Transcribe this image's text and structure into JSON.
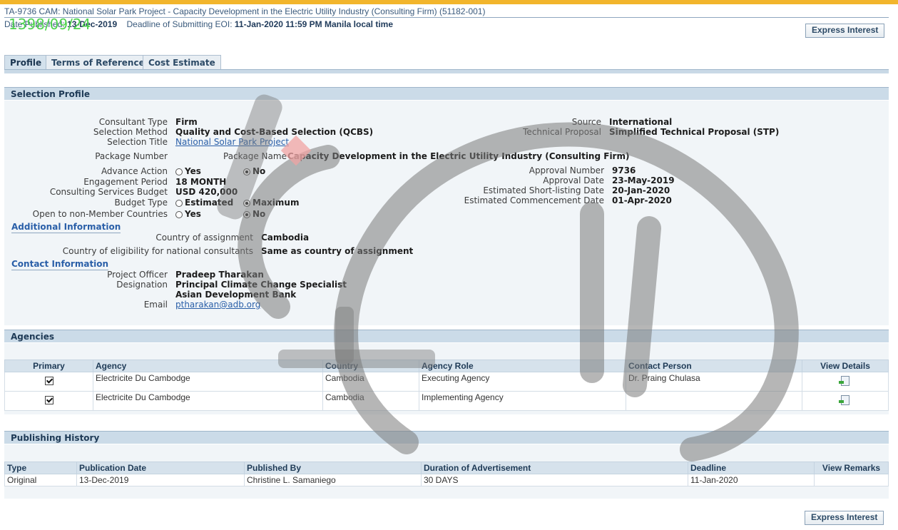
{
  "header": {
    "title": "TA-9736 CAM: National Solar Park Project - Capacity Development in the Electric Utility Industry (Consulting Firm) (51182-001)",
    "date_published_label": "Date Published:",
    "date_published_value": "13-Dec-2019",
    "deadline_label": "Deadline of Submitting EOI:",
    "deadline_value": "11-Jan-2020 11:59 PM Manila local time",
    "stamp": "1398/09/24",
    "express_interest": "Express Interest"
  },
  "tabs": [
    {
      "label": "Profile",
      "active": true
    },
    {
      "label": "Terms of Reference",
      "active": false
    },
    {
      "label": "Cost Estimate",
      "active": false
    }
  ],
  "selection_profile": {
    "heading": "Selection Profile",
    "consultant_type_label": "Consultant Type",
    "consultant_type": "Firm",
    "selection_method_label": "Selection Method",
    "selection_method": "Quality and Cost-Based Selection (QCBS)",
    "selection_title_label": "Selection Title",
    "selection_title": "National Solar Park Project",
    "package_number_label": "Package Number",
    "package_name_label": "Package Name",
    "package_name": "Capacity Development in the Electric Utility Industry (Consulting Firm)",
    "advance_action_label": "Advance Action",
    "advance_action_options": [
      "Yes",
      "No"
    ],
    "advance_action_selected": "No",
    "engagement_period_label": "Engagement Period",
    "engagement_period": "18 MONTH",
    "budget_label": "Consulting Services Budget",
    "budget": "USD 420,000",
    "budget_type_label": "Budget Type",
    "budget_type_options": [
      "Estimated",
      "Maximum"
    ],
    "budget_type_selected": "Maximum",
    "open_label": "Open to non-Member Countries",
    "open_options": [
      "Yes",
      "No"
    ],
    "open_selected": "No",
    "source_label": "Source",
    "source": "International",
    "technical_proposal_label": "Technical Proposal",
    "technical_proposal": "Simplified Technical Proposal (STP)",
    "approval_number_label": "Approval Number",
    "approval_number": "9736",
    "approval_date_label": "Approval Date",
    "approval_date": "23-May-2019",
    "shortlisting_label": "Estimated Short-listing Date",
    "shortlisting": "20-Jan-2020",
    "commencement_label": "Estimated Commencement Date",
    "commencement": "01-Apr-2020"
  },
  "additional_information": {
    "heading": "Additional Information",
    "country_assignment_label": "Country of assignment",
    "country_assignment": "Cambodia",
    "country_eligibility_label": "Country of eligibility for national consultants",
    "country_eligibility": "Same as country of assignment"
  },
  "contact_information": {
    "heading": "Contact Information",
    "project_officer_label": "Project Officer",
    "project_officer": "Pradeep Tharakan",
    "designation_label": "Designation",
    "designation": "Principal Climate Change Specialist",
    "organization": "Asian Development Bank",
    "email_label": "Email",
    "email": "ptharakan@adb.org"
  },
  "agencies": {
    "heading": "Agencies",
    "columns": [
      "Primary",
      "Agency",
      "Country",
      "Agency Role",
      "Contact Person",
      "View Details"
    ],
    "rows": [
      {
        "agency": "Electricite Du Cambodge",
        "country": "Cambodia",
        "role": "Executing Agency",
        "contact": "Dr. Praing Chulasa"
      },
      {
        "agency": "Electricite Du Cambodge",
        "country": "Cambodia",
        "role": "Implementing Agency",
        "contact": ""
      }
    ]
  },
  "publishing_history": {
    "heading": "Publishing History",
    "columns": [
      "Type",
      "Publication Date",
      "Published By",
      "Duration of Advertisement",
      "Deadline",
      "View Remarks"
    ],
    "rows": [
      {
        "type": "Original",
        "date": "13-Dec-2019",
        "by": "Christine L. Samaniego",
        "duration": "30 DAYS",
        "deadline": "11-Jan-2020",
        "remarks": ""
      }
    ]
  },
  "colors": {
    "accent_bar": "#f2b52c",
    "section_header": "#cbdbe8",
    "link": "#2a5fa8",
    "stamp": "#4fd24f"
  }
}
